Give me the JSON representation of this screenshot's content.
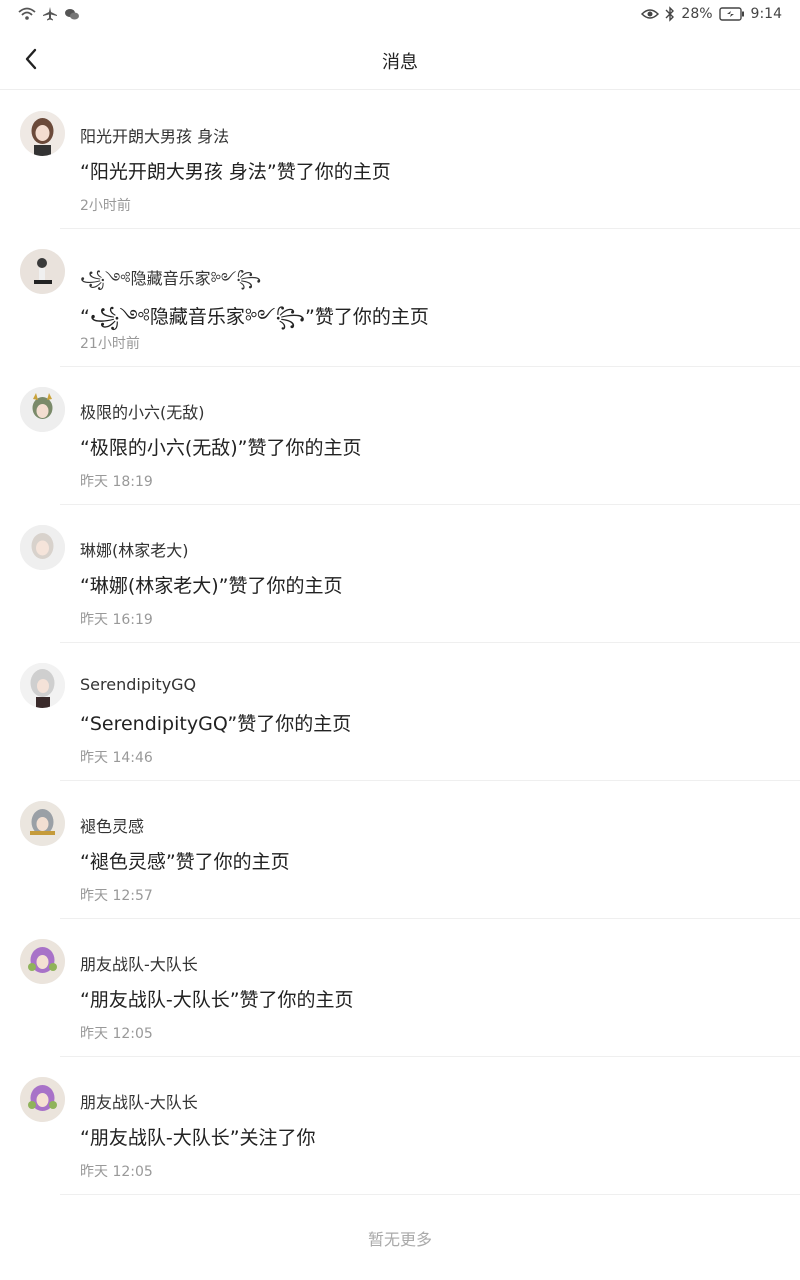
{
  "status_bar": {
    "battery": "28%",
    "time": "9:14",
    "icons": [
      "wifi-icon",
      "airplane-icon",
      "wechat-icon",
      "eye-icon",
      "bluetooth-icon",
      "battery-icon"
    ]
  },
  "header": {
    "title": "消息",
    "back_icon": "chevron-left-icon"
  },
  "messages": [
    {
      "name": "阳光开朗大男孩 身法",
      "text": "“阳光开朗大男孩 身法”赞了你的主页",
      "time": "2小时前",
      "avatar_color": "#6b4a3a"
    },
    {
      "name": "꧁༺隐藏音乐家༻꧂",
      "text": "“꧁༺隐藏音乐家༻꧂”赞了你的主页",
      "time": "21小时前",
      "avatar_color": "#e9e2dc"
    },
    {
      "name": "极限的小六(无敌)",
      "text": "“极限的小六(无敌)”赞了你的主页",
      "time": "昨天 18:19",
      "avatar_color": "#7a8a6a"
    },
    {
      "name": "琳娜(林家老大)",
      "text": "“琳娜(林家老大)”赞了你的主页",
      "time": "昨天 16:19",
      "avatar_color": "#d8d2cc"
    },
    {
      "name": "SerendipityGQ",
      "text": "“SerendipityGQ”赞了你的主页",
      "time": "昨天 14:46",
      "avatar_color": "#cfcfcf"
    },
    {
      "name": "褪色灵感",
      "text": "“褪色灵感”赞了你的主页",
      "time": "昨天 12:57",
      "avatar_color": "#9aa0a6"
    },
    {
      "name": "朋友战队-大队长",
      "text": "“朋友战队-大队长”赞了你的主页",
      "time": "昨天 12:05",
      "avatar_color": "#a872c8"
    },
    {
      "name": "朋友战队-大队长",
      "text": "“朋友战队-大队长”关注了你",
      "time": "昨天 12:05",
      "avatar_color": "#a872c8"
    }
  ],
  "footer": {
    "no_more": "暂无更多"
  }
}
